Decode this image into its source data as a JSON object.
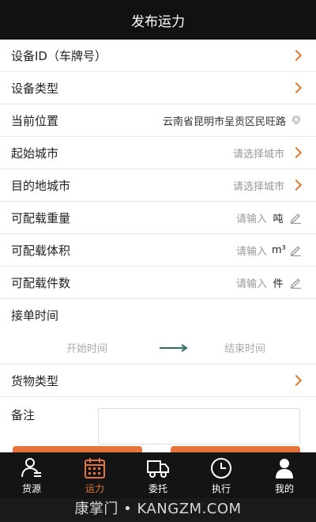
{
  "header": {
    "title": "发布运力"
  },
  "rows": [
    {
      "label": "设备ID（车牌号）",
      "value": ""
    },
    {
      "label": "设备类型",
      "value": ""
    },
    {
      "label": "当前位置",
      "value": "云南省昆明市呈贡区民旺路"
    },
    {
      "label": "起始城市",
      "value": "请选择城市"
    },
    {
      "label": "目的地城市",
      "value": "请选择城市"
    },
    {
      "label": "可配载重量",
      "placeholder": "请输入",
      "unit": "吨"
    },
    {
      "label": "可配载体积",
      "placeholder": "请输入",
      "unit": "m³"
    },
    {
      "label": "可配载件数",
      "placeholder": "请输入",
      "unit": "件"
    },
    {
      "label": "接单时间"
    }
  ],
  "time": {
    "start": "开始时间",
    "end": "结束时间"
  },
  "cargo": {
    "label": "货物类型"
  },
  "remark": {
    "label": "备注",
    "value": ""
  },
  "tabs": [
    {
      "label": "货源",
      "icon": "user-icon",
      "active": false
    },
    {
      "label": "运力",
      "icon": "calendar-icon",
      "active": true
    },
    {
      "label": "委托",
      "icon": "truck-icon",
      "active": false
    },
    {
      "label": "执行",
      "icon": "clock-icon",
      "active": false
    },
    {
      "label": "我的",
      "icon": "person-icon",
      "active": false
    }
  ],
  "watermark": "康掌门 • KANGZM.COM",
  "colors": {
    "accent": "#e4743b",
    "header": "#111111",
    "tabbar": "#141414"
  }
}
